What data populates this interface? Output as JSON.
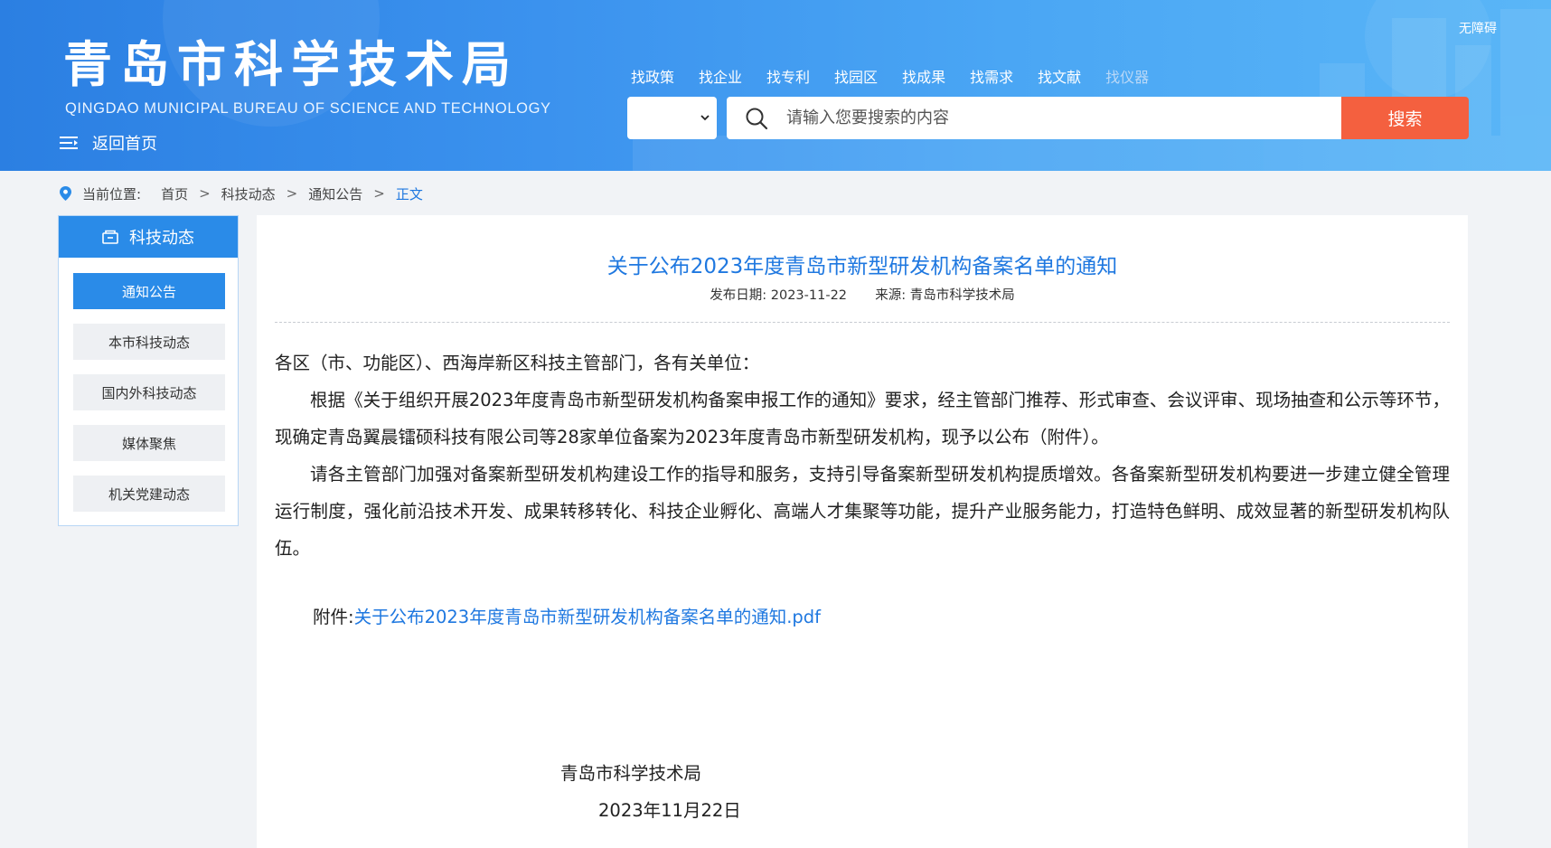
{
  "header": {
    "logo_cn": "青岛市科学技术局",
    "logo_en": "QINGDAO MUNICIPAL BUREAU OF SCIENCE AND TECHNOLOGY",
    "back_home": "返回首页",
    "accessibility": "无障碍",
    "nav": [
      {
        "label": "找政策"
      },
      {
        "label": "找企业"
      },
      {
        "label": "找专利"
      },
      {
        "label": "找园区"
      },
      {
        "label": "找成果"
      },
      {
        "label": "找需求"
      },
      {
        "label": "找文献"
      },
      {
        "label": "找仪器"
      }
    ],
    "search": {
      "select_value": "",
      "placeholder": "请输入您要搜索的内容",
      "button": "搜索"
    },
    "icons": {
      "menu": "menu-icon",
      "search": "search-icon",
      "caret": "chevron-down-icon"
    }
  },
  "breadcrumb": {
    "label": "当前位置:",
    "items": [
      "首页",
      "科技动态",
      "通知公告",
      "正文"
    ],
    "separator": ">"
  },
  "sidebar": {
    "title": "科技动态",
    "items": [
      {
        "label": "通知公告",
        "active": true
      },
      {
        "label": "本市科技动态",
        "active": false
      },
      {
        "label": "国内外科技动态",
        "active": false
      },
      {
        "label": "媒体聚焦",
        "active": false
      },
      {
        "label": "机关党建动态",
        "active": false
      }
    ]
  },
  "article": {
    "title": "关于公布2023年度青岛市新型研发机构备案名单的通知",
    "date_label": "发布日期:",
    "date": "2023-11-22",
    "source_label": "来源:",
    "source": "青岛市科学技术局",
    "paragraphs": [
      "各区（市、功能区）、西海岸新区科技主管部门，各有关单位：",
      "根据《关于组织开展2023年度青岛市新型研发机构备案申报工作的通知》要求，经主管部门推荐、形式审查、会议评审、现场抽查和公示等环节，现确定青岛翼晨镭硕科技有限公司等28家单位备案为2023年度青岛市新型研发机构，现予以公布（附件）。",
      "请各主管部门加强对备案新型研发机构建设工作的指导和服务，支持引导备案新型研发机构提质增效。各备案新型研发机构要进一步建立健全管理运行制度，强化前沿技术开发、成果转移转化、科技企业孵化、高端人才集聚等功能，提升产业服务能力，打造特色鲜明、成效显著的新型研发机构队伍。"
    ],
    "attachment_label": "附件:",
    "attachment_link": "关于公布2023年度青岛市新型研发机构备案名单的通知.pdf",
    "signature_org": "青岛市科学技术局",
    "signature_date": "2023年11月22日"
  },
  "colors": {
    "header_blue": "#2b7fe2",
    "accent_blue": "#1f78e0",
    "sidebar_blue": "#2a8be8",
    "search_button": "#f4603f",
    "page_bg": "#f1f3f6"
  }
}
